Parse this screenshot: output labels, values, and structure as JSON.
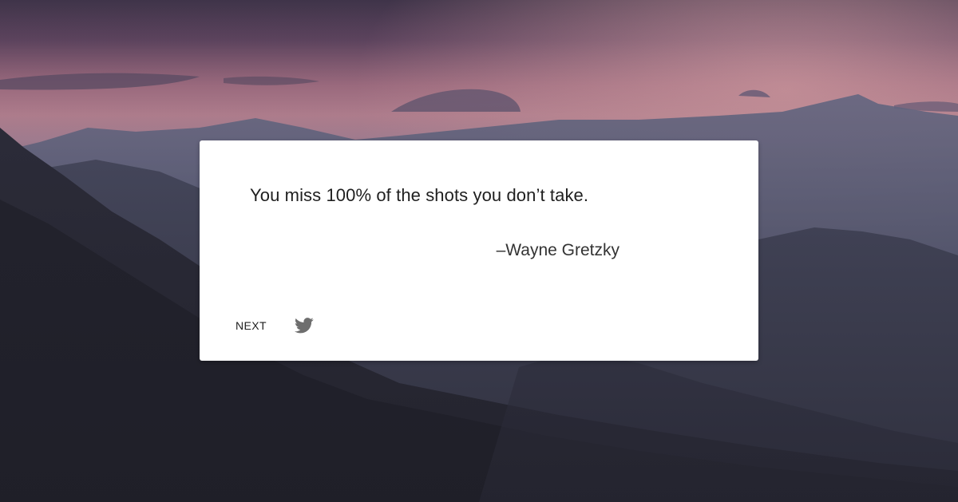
{
  "quote": {
    "text": "You miss 100% of the shots you don’t take.",
    "author": "–Wayne Gretzky"
  },
  "actions": {
    "next_label": "NEXT",
    "tweet_icon": "twitter-icon"
  },
  "colors": {
    "card_background": "#ffffff",
    "text": "#1f1f1f",
    "icon": "#6e6e6e",
    "sky_top": "#4a3a55",
    "sky_glow": "#d9a0a8",
    "mountains_dark": "#23232e"
  }
}
